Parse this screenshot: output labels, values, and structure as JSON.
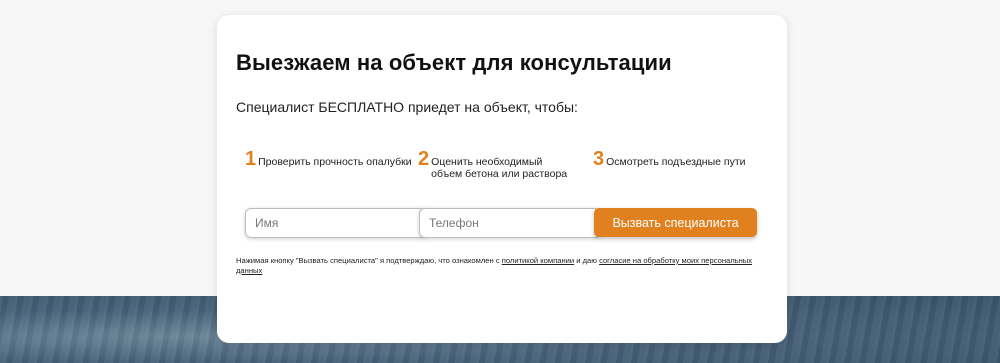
{
  "card": {
    "title": "Выезжаем на объект для консультации",
    "subtitle": "Специалист БЕСПЛАТНО приедет на объект, чтобы:"
  },
  "steps": [
    {
      "num": "1",
      "text": "Проверить прочность опалубки"
    },
    {
      "num": "2",
      "text": "Оценить необходимый объем бетона или раствора"
    },
    {
      "num": "3",
      "text": "Осмотреть подъездные пути"
    }
  ],
  "form": {
    "name_placeholder": "Имя",
    "phone_placeholder": "Телефон",
    "submit_label": "Вызвать специалиста"
  },
  "consent": {
    "prefix": "Нажимая кнопку \"Вызвать специалиста\" я подтверждаю, что ознакомлен с ",
    "policy_link": "политикой компании",
    "middle": " и даю ",
    "agreement_link": "согласие на обработку моих персональных данных"
  },
  "colors": {
    "accent": "#e0801f",
    "background_bottom": "#48627a"
  }
}
